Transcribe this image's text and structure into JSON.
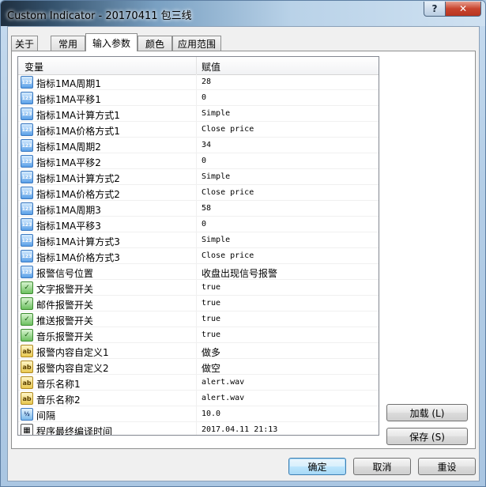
{
  "window": {
    "title": "Custom Indicator - 20170411 包三线"
  },
  "tabs": [
    {
      "label": "关于"
    },
    {
      "label": "常用"
    },
    {
      "label": "输入参数"
    },
    {
      "label": "颜色"
    },
    {
      "label": "应用范围"
    }
  ],
  "grid": {
    "header": {
      "name": "变量",
      "value": "赋值"
    },
    "rows": [
      {
        "icon": "integer-icon",
        "name": "指标1MA周期1",
        "value": "28"
      },
      {
        "icon": "integer-icon",
        "name": "指标1MA平移1",
        "value": "0"
      },
      {
        "icon": "integer-icon",
        "name": "指标1MA计算方式1",
        "value": "Simple"
      },
      {
        "icon": "integer-icon",
        "name": "指标1MA价格方式1",
        "value": "Close price"
      },
      {
        "icon": "integer-icon",
        "name": "指标1MA周期2",
        "value": "34"
      },
      {
        "icon": "integer-icon",
        "name": "指标1MA平移2",
        "value": "0"
      },
      {
        "icon": "integer-icon",
        "name": "指标1MA计算方式2",
        "value": "Simple"
      },
      {
        "icon": "integer-icon",
        "name": "指标1MA价格方式2",
        "value": "Close price"
      },
      {
        "icon": "integer-icon",
        "name": "指标1MA周期3",
        "value": "58"
      },
      {
        "icon": "integer-icon",
        "name": "指标1MA平移3",
        "value": "0"
      },
      {
        "icon": "integer-icon",
        "name": "指标1MA计算方式3",
        "value": "Simple"
      },
      {
        "icon": "integer-icon",
        "name": "指标1MA价格方式3",
        "value": "Close price"
      },
      {
        "icon": "integer-icon",
        "name": "报警信号位置",
        "value": "收盘出现信号报警"
      },
      {
        "icon": "boolean-icon",
        "name": "文字报警开关",
        "value": "true"
      },
      {
        "icon": "boolean-icon",
        "name": "邮件报警开关",
        "value": "true"
      },
      {
        "icon": "boolean-icon",
        "name": "推送报警开关",
        "value": "true"
      },
      {
        "icon": "boolean-icon",
        "name": "音乐报警开关",
        "value": "true"
      },
      {
        "icon": "string-icon",
        "name": "报警内容自定义1",
        "value": "做多"
      },
      {
        "icon": "string-icon",
        "name": "报警内容自定义2",
        "value": "做空"
      },
      {
        "icon": "string-icon",
        "name": "音乐名称1",
        "value": "alert.wav"
      },
      {
        "icon": "string-icon",
        "name": "音乐名称2",
        "value": "alert.wav"
      },
      {
        "icon": "double-icon",
        "name": "间隔",
        "value": "10.0"
      },
      {
        "icon": "datetime-icon",
        "name": "程序最终编译时间",
        "value": "2017.04.11 21:13"
      }
    ]
  },
  "side_buttons": {
    "load": "加载 (L)",
    "save": "保存 (S)"
  },
  "footer_buttons": {
    "ok": "确定",
    "cancel": "取消",
    "reset": "重设"
  }
}
